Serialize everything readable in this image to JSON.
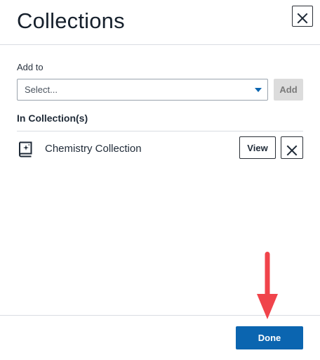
{
  "dialog": {
    "title": "Collections",
    "close_icon": "close-icon"
  },
  "add": {
    "label": "Add to",
    "select_value": "Select...",
    "button_label": "Add"
  },
  "collections": {
    "heading": "In Collection(s)",
    "items": [
      {
        "name": "Chemistry Collection",
        "icon": "book-sparkle-icon",
        "view_label": "View",
        "remove_icon": "close-icon"
      }
    ]
  },
  "footer": {
    "done_label": "Done"
  },
  "colors": {
    "primary": "#0b65b0",
    "annotation_arrow": "#f0444b",
    "disabled_button": "#dcdcdc",
    "divider": "#d9dde2"
  }
}
